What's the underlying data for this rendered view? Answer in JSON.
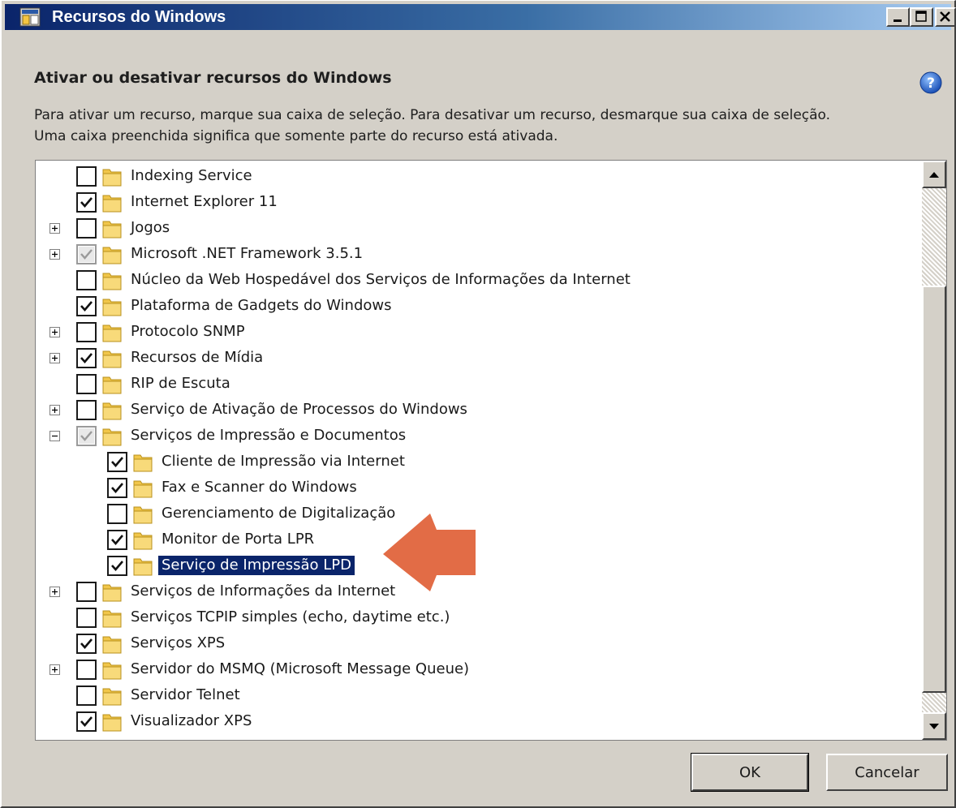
{
  "window": {
    "title": "Recursos do Windows",
    "heading": "Ativar ou desativar recursos do Windows",
    "description_line1": "Para ativar um recurso, marque sua caixa de seleção. Para desativar um recurso, desmarque sua caixa de seleção.",
    "description_line2": "Uma caixa preenchida significa que somente parte do recurso está ativada."
  },
  "icons": {
    "title": "windows-features-icon",
    "help": "help-icon",
    "folder": "folder-icon",
    "annotation": "red-arrow-annotation"
  },
  "colors": {
    "titlebar_start": "#0a246a",
    "titlebar_end": "#a6caf0",
    "selection": "#0a246a",
    "annotation_arrow": "#e0643c",
    "dialog_face": "#d4d0c8"
  },
  "features": [
    {
      "label": "Indexing Service",
      "state": "unchecked",
      "expander": "none",
      "level": 0
    },
    {
      "label": "Internet Explorer 11",
      "state": "checked",
      "expander": "none",
      "level": 0
    },
    {
      "label": "Jogos",
      "state": "unchecked",
      "expander": "plus",
      "level": 0
    },
    {
      "label": "Microsoft .NET Framework 3.5.1",
      "state": "partial",
      "expander": "plus",
      "level": 0
    },
    {
      "label": "Núcleo da Web Hospedável dos Serviços de Informações da Internet",
      "state": "unchecked",
      "expander": "none",
      "level": 0
    },
    {
      "label": "Plataforma de Gadgets do Windows",
      "state": "checked",
      "expander": "none",
      "level": 0
    },
    {
      "label": "Protocolo SNMP",
      "state": "unchecked",
      "expander": "plus",
      "level": 0
    },
    {
      "label": "Recursos de Mídia",
      "state": "checked",
      "expander": "plus",
      "level": 0
    },
    {
      "label": "RIP de Escuta",
      "state": "unchecked",
      "expander": "none",
      "level": 0
    },
    {
      "label": "Serviço de Ativação de Processos do Windows",
      "state": "unchecked",
      "expander": "plus",
      "level": 0
    },
    {
      "label": "Serviços de Impressão e Documentos",
      "state": "partial",
      "expander": "minus",
      "level": 0
    },
    {
      "label": "Cliente de Impressão via Internet",
      "state": "checked",
      "expander": "none",
      "level": 1
    },
    {
      "label": "Fax e Scanner do Windows",
      "state": "checked",
      "expander": "none",
      "level": 1
    },
    {
      "label": "Gerenciamento de Digitalização",
      "state": "unchecked",
      "expander": "none",
      "level": 1
    },
    {
      "label": "Monitor de Porta LPR",
      "state": "checked",
      "expander": "none",
      "level": 1
    },
    {
      "label": "Serviço de Impressão LPD",
      "state": "checked",
      "expander": "none",
      "level": 1,
      "selected": true
    },
    {
      "label": "Serviços de Informações da Internet",
      "state": "unchecked",
      "expander": "plus",
      "level": 0
    },
    {
      "label": "Serviços TCPIP simples (echo, daytime etc.)",
      "state": "unchecked",
      "expander": "none",
      "level": 0
    },
    {
      "label": "Serviços XPS",
      "state": "checked",
      "expander": "none",
      "level": 0
    },
    {
      "label": "Servidor do MSMQ (Microsoft Message Queue)",
      "state": "unchecked",
      "expander": "plus",
      "level": 0
    },
    {
      "label": "Servidor Telnet",
      "state": "unchecked",
      "expander": "none",
      "level": 0
    },
    {
      "label": "Visualizador XPS",
      "state": "checked",
      "expander": "none",
      "level": 0
    }
  ],
  "buttons": {
    "ok": "OK",
    "cancel": "Cancelar"
  }
}
